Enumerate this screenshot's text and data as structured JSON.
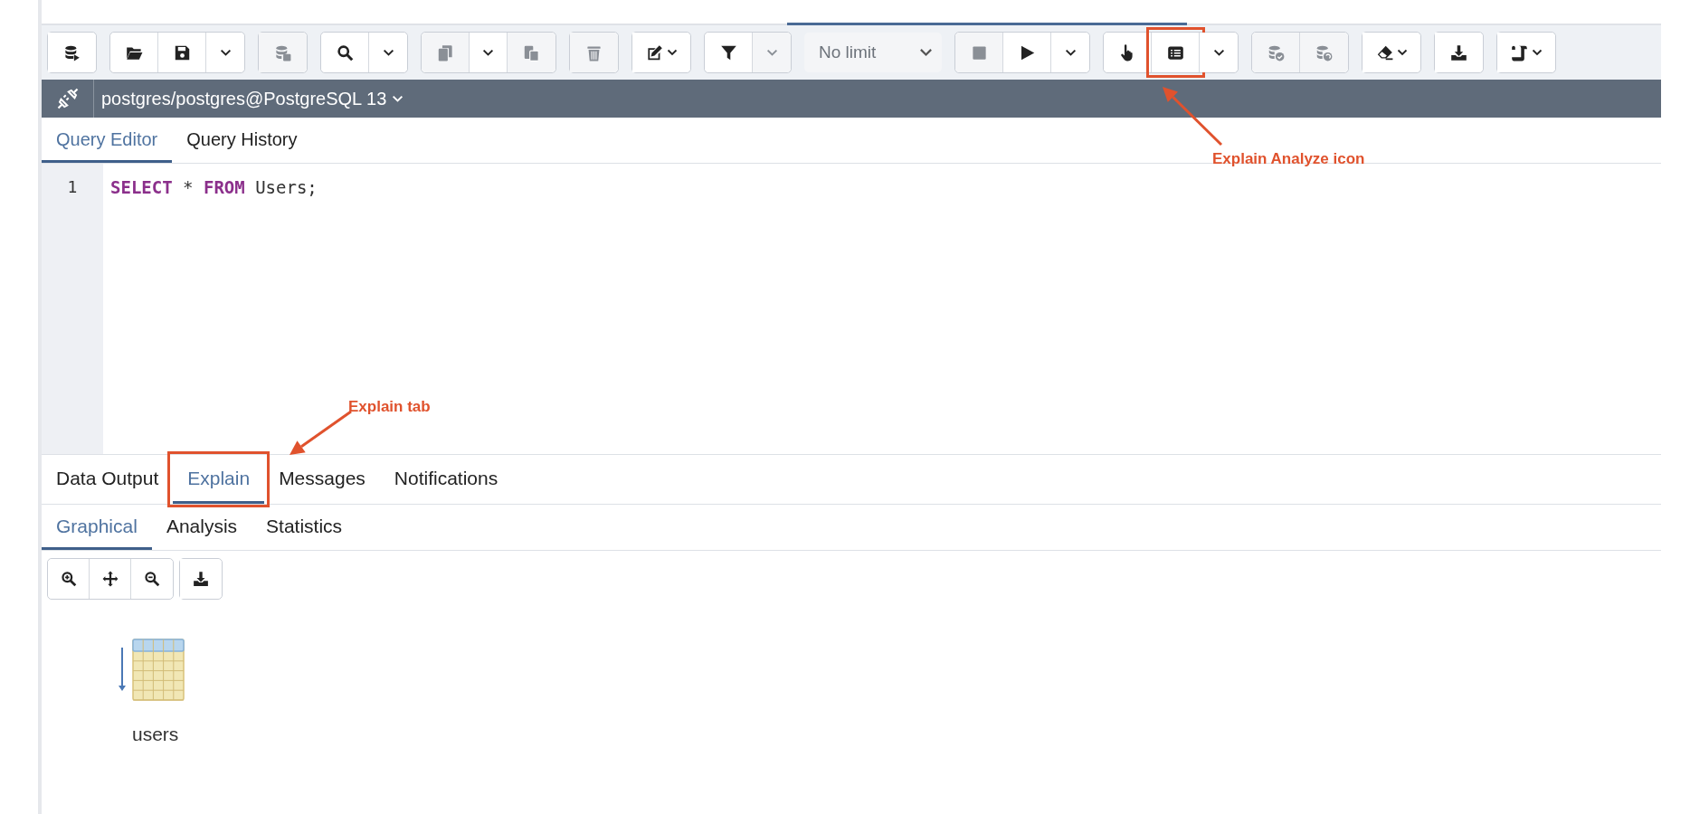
{
  "toolbar": [
    {
      "buttons": [
        {
          "kind": "icon",
          "disabled": false
        }
      ]
    },
    {
      "buttons": [
        {
          "kind": "icon",
          "disabled": false
        },
        {
          "kind": "icon",
          "disabled": false
        },
        {
          "kind": "caret",
          "disabled": false
        }
      ]
    },
    {
      "buttons": [
        {
          "kind": "icon",
          "disabled": true
        }
      ]
    },
    {
      "buttons": [
        {
          "kind": "icon",
          "disabled": false
        },
        {
          "kind": "caret",
          "disabled": false
        }
      ]
    },
    {
      "buttons": [
        {
          "kind": "icon",
          "disabled": true
        },
        {
          "kind": "caret",
          "disabled": false
        },
        {
          "kind": "icon",
          "disabled": true
        }
      ]
    },
    {
      "buttons": [
        {
          "kind": "icon",
          "disabled": true
        }
      ]
    },
    {
      "buttons": [
        {
          "kind": "icon-caret",
          "disabled": false
        }
      ]
    },
    {
      "buttons": [
        {
          "kind": "icon",
          "disabled": false
        },
        {
          "kind": "caret",
          "disabled": true
        }
      ]
    },
    {
      "buttons": [
        {
          "kind": "select",
          "value": "No limit"
        }
      ]
    },
    {
      "buttons": [
        {
          "kind": "icon",
          "disabled": true
        },
        {
          "kind": "icon",
          "disabled": false
        },
        {
          "kind": "caret",
          "disabled": false
        }
      ]
    },
    {
      "buttons": [
        {
          "kind": "icon",
          "disabled": false
        },
        {
          "kind": "icon",
          "disabled": false,
          "highlighted": true
        },
        {
          "kind": "caret",
          "disabled": false
        }
      ]
    },
    {
      "buttons": [
        {
          "kind": "icon",
          "disabled": true
        },
        {
          "kind": "icon",
          "disabled": true
        }
      ]
    },
    {
      "buttons": [
        {
          "kind": "icon-caret",
          "disabled": false
        }
      ]
    },
    {
      "buttons": [
        {
          "kind": "icon",
          "disabled": false
        }
      ]
    },
    {
      "buttons": [
        {
          "kind": "icon-caret",
          "disabled": false
        }
      ]
    }
  ],
  "connection": {
    "label": "postgres/postgres@PostgreSQL 13"
  },
  "editor_tabs": [
    {
      "label": "Query Editor",
      "selected": true
    },
    {
      "label": "Query History",
      "selected": false
    }
  ],
  "editor": {
    "lines": [
      {
        "number": "1",
        "tokens": [
          {
            "text": "SELECT",
            "kind": "keyword"
          },
          {
            "text": " * ",
            "kind": "plain"
          },
          {
            "text": "FROM",
            "kind": "keyword"
          },
          {
            "text": " Users;",
            "kind": "plain"
          }
        ]
      }
    ]
  },
  "result_tabs": [
    {
      "label": "Data Output",
      "selected": false
    },
    {
      "label": "Explain",
      "selected": true,
      "highlighted": true
    },
    {
      "label": "Messages",
      "selected": false
    },
    {
      "label": "Notifications",
      "selected": false
    }
  ],
  "explain_tabs": [
    {
      "label": "Graphical",
      "selected": true
    },
    {
      "label": "Analysis",
      "selected": false
    },
    {
      "label": "Statistics",
      "selected": false
    }
  ],
  "plan": {
    "nodes": [
      {
        "label": "users"
      }
    ]
  },
  "annotations": [
    {
      "text": "Explain Analyze icon"
    },
    {
      "text": "Explain tab"
    }
  ]
}
